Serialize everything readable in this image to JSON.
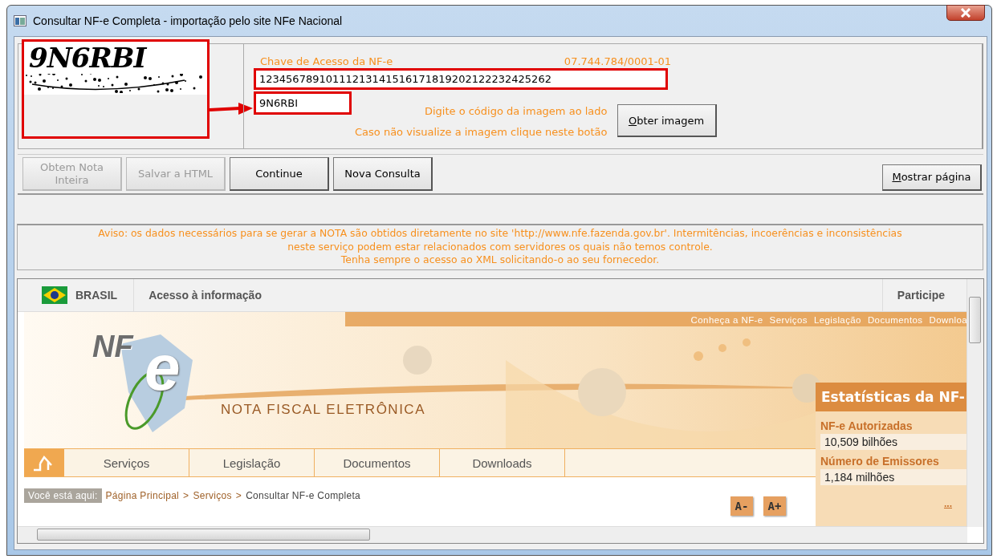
{
  "window": {
    "title": "Consultar NF-e Completa - importação pelo site NFe Nacional"
  },
  "captcha": {
    "text": "9N6RBI"
  },
  "form": {
    "key_label": "Chave de Acesso da NF-e",
    "cnpj": "07.744.784/0001-01",
    "key_value": "12345678910111213141516171819202122232425262",
    "code_value": "9N6RBI",
    "code_hint": "Digite o código da imagem ao lado",
    "image_hint": "Caso não visualize a imagem clique neste botão",
    "image_button": {
      "label": "Obter imagem",
      "underline_first": true
    }
  },
  "actions": [
    {
      "label": "Obtem Nota Inteira",
      "disabled": true
    },
    {
      "label": "Salvar a HTML",
      "disabled": true
    },
    {
      "label": "Continue",
      "disabled": false
    },
    {
      "label": "Nova Consulta",
      "disabled": false
    }
  ],
  "show_page_button": {
    "label": "Mostrar página",
    "underline_first": true
  },
  "notice": [
    "Aviso: os dados necessários para se gerar a NOTA são obtidos diretamente no site 'http://www.nfe.fazenda.gov.br'. Intermitências, incoerências e inconsistências",
    "neste serviço podem estar relacionados com servidores os quais não temos controle.",
    "Tenha sempre o acesso ao XML solicitando-o ao seu fornecedor."
  ],
  "browser": {
    "gov_bar": {
      "country": "BRASIL",
      "access": "Acesso à informação",
      "participate": "Participe"
    },
    "top_links": [
      "Conheça a NF-e",
      "Serviços",
      "Legislação",
      "Documentos",
      "Downloa"
    ],
    "logo": {
      "letters": "NF",
      "big_letter": "e",
      "tagline": "NOTA FISCAL ELETRÔNICA"
    },
    "menu": [
      {
        "label": "Serviços"
      },
      {
        "label": "Legislação"
      },
      {
        "label": "Documentos"
      },
      {
        "label": "Downloads"
      }
    ],
    "breadcrumb": {
      "label": "Você está aqui:",
      "items": [
        {
          "text": "Página Principal",
          "kind": "link"
        },
        {
          "text": ">",
          "kind": "separator"
        },
        {
          "text": "Serviços",
          "kind": "link"
        },
        {
          "text": ">",
          "kind": "separator"
        },
        {
          "text": "Consultar NF-e Completa",
          "kind": "current"
        }
      ]
    },
    "font_buttons": [
      "A-",
      "A+"
    ],
    "stats": {
      "title": "Estatísticas da NF-",
      "items": [
        {
          "label": "NF-e Autorizadas",
          "value": "10,509 bilhões"
        },
        {
          "label": "Número de Emissores",
          "value": "1,184 milhões"
        }
      ],
      "more": "..."
    }
  }
}
